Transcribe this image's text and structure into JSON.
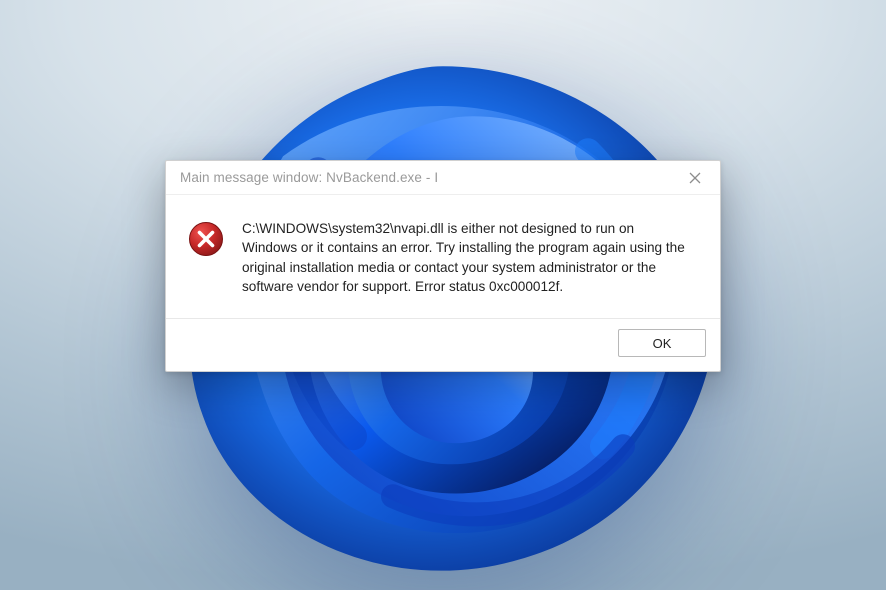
{
  "dialog": {
    "title": "Main message window: NvBackend.exe - I",
    "close_label": "Close",
    "icon": "error-icon",
    "message": "C:\\WINDOWS\\system32\\nvapi.dll is either not designed to run on Windows or it contains an error. Try installing the program again using the original installation media or contact your system administrator or the software vendor for support. Error status 0xc000012f.",
    "ok_label": "OK"
  },
  "colors": {
    "error_red": "#c62828",
    "error_red_dark": "#8f1a1a",
    "dialog_bg": "#ffffff",
    "bloom_blue_a": "#0a5af0",
    "bloom_blue_b": "#1e7dff",
    "bloom_blue_c": "#0b3cbd",
    "bloom_blue_d": "#062a86"
  }
}
